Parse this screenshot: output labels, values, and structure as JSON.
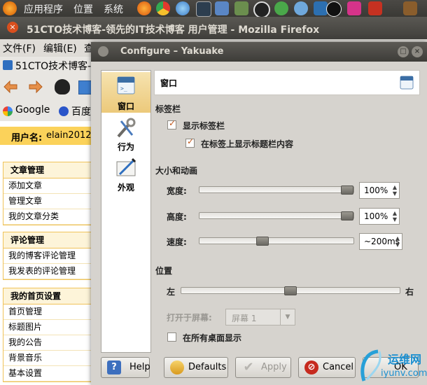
{
  "panel": {
    "menus": [
      "应用程序",
      "位置",
      "系统"
    ]
  },
  "firefox": {
    "title": "51CTO技术博客-领先的IT技术博客 用户管理 - Mozilla Firefox",
    "menus": [
      "文件(F)",
      "编辑(E)",
      "查"
    ],
    "tab_title": "51CTO技术博客-",
    "bookmarks": [
      "Google",
      "百度"
    ]
  },
  "webpage": {
    "user_label": "用户名:",
    "user_name": "elain2012",
    "sections": [
      {
        "title": "文章管理",
        "items": [
          "添加文章",
          "管理文章",
          "我的文章分类"
        ]
      },
      {
        "title": "评论管理",
        "items": [
          "我的博客评论管理",
          "我发表的评论管理"
        ]
      },
      {
        "title": "我的首页设置",
        "items": [
          "首页管理",
          "标题图片",
          "我的公告",
          "背景音乐",
          "基本设置"
        ]
      }
    ]
  },
  "dialog": {
    "title": "Configure – Yakuake",
    "sidebar": [
      {
        "label": "窗口",
        "icon": "window-icon",
        "selected": true
      },
      {
        "label": "行为",
        "icon": "tools-icon",
        "selected": false
      },
      {
        "label": "外观",
        "icon": "appearance-icon",
        "selected": false
      }
    ],
    "page_title": "窗口",
    "tabbar": {
      "heading": "标签栏",
      "show_tabbar": "显示标签栏",
      "show_title_on_tab": "在标签上显示标题栏内容",
      "show_tabbar_checked": true,
      "show_title_checked": true
    },
    "size": {
      "heading": "大小和动画",
      "width_label": "宽度:",
      "width_value": "100%",
      "width_level": 1.0,
      "height_label": "高度:",
      "height_value": "100%",
      "height_level": 1.0,
      "speed_label": "速度:",
      "speed_value": "~200ms",
      "speed_level": 0.4
    },
    "position": {
      "heading": "位置",
      "left_label": "左",
      "right_label": "右",
      "level": 0.5,
      "screen_label": "打开于屏幕:",
      "screen_value": "屏幕 1",
      "all_desktops": "在所有桌面显示",
      "all_desktops_checked": false
    },
    "buttons": {
      "help": "Help",
      "defaults": "Defaults",
      "apply": "Apply",
      "cancel": "Cancel",
      "ok": "OK"
    }
  },
  "watermark": {
    "line1": "运维网",
    "line2": "iyunv.com"
  },
  "colors": {
    "accent": "#ecc97a",
    "checkmark": "#c0561a",
    "cancel_red": "#c62a1e"
  }
}
